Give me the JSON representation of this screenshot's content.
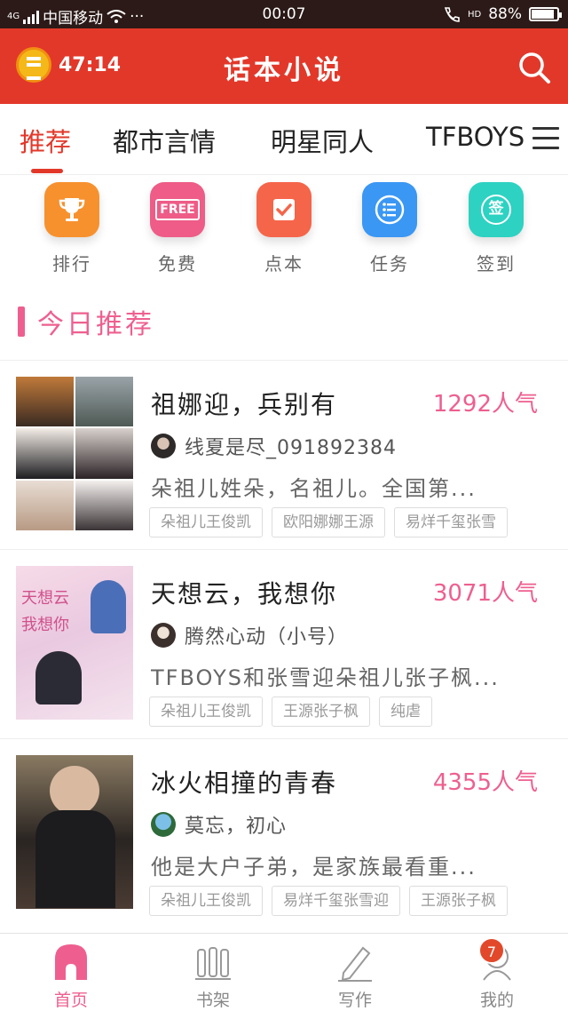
{
  "status_bar": {
    "carrier": "中国移动",
    "network": "4G",
    "time": "00:07",
    "signal_hd": "HD",
    "battery": "88%",
    "battery_level": 0.88
  },
  "header": {
    "timer": "47:14",
    "title": "话本小说",
    "search_icon": "search-icon",
    "timer_icon": "alarm-coin-icon"
  },
  "tabs": [
    {
      "label": "推荐",
      "active": true
    },
    {
      "label": "都市言情",
      "active": false
    },
    {
      "label": "明星同人",
      "active": false
    },
    {
      "label": "TFBOYS",
      "active": false
    }
  ],
  "quick_actions": [
    {
      "label": "排行",
      "icon": "trophy-icon",
      "color": "#f7912e"
    },
    {
      "label": "免费",
      "icon": "free-icon",
      "color": "#ee5c87",
      "icon_text": "FREE"
    },
    {
      "label": "点本",
      "icon": "check-note-icon",
      "color": "#f5654a"
    },
    {
      "label": "任务",
      "icon": "task-list-icon",
      "color": "#3a97f4"
    },
    {
      "label": "签到",
      "icon": "sign-in-icon",
      "color": "#2dd2c2",
      "icon_text": "签"
    }
  ],
  "section": {
    "title": "今日推荐"
  },
  "books": [
    {
      "title": "祖娜迎，兵别有",
      "popularity": "1292人气",
      "author": "线夏是尽_091892384",
      "description": "朵祖儿姓朵，名祖儿。全国第...",
      "tags": [
        "朵祖儿王俊凯",
        "欧阳娜娜王源",
        "易烊千玺张雪"
      ]
    },
    {
      "title": "天想云，我想你",
      "popularity": "3071人气",
      "author": "腾然心动（小号）",
      "description": "TFBOYS和张雪迎朵祖儿张子枫...",
      "tags": [
        "朵祖儿王俊凯",
        "王源张子枫",
        "纯虐"
      ],
      "cover_text": [
        "天想云",
        "我想你"
      ]
    },
    {
      "title": "冰火相撞的青春",
      "popularity": "4355人气",
      "author": "莫忘，初心",
      "description": "他是大户子弟，是家族最看重...",
      "tags": [
        "朵祖儿王俊凯",
        "易烊千玺张雪迎",
        "王源张子枫"
      ]
    }
  ],
  "bottom_nav": [
    {
      "label": "首页",
      "icon": "home-icon",
      "active": true
    },
    {
      "label": "书架",
      "icon": "bookshelf-icon",
      "active": false
    },
    {
      "label": "写作",
      "icon": "pencil-icon",
      "active": false
    },
    {
      "label": "我的",
      "icon": "profile-icon",
      "active": false,
      "badge": "7"
    }
  ],
  "colors": {
    "brand_red": "#e2382a",
    "accent_pink": "#ee5f8f"
  }
}
